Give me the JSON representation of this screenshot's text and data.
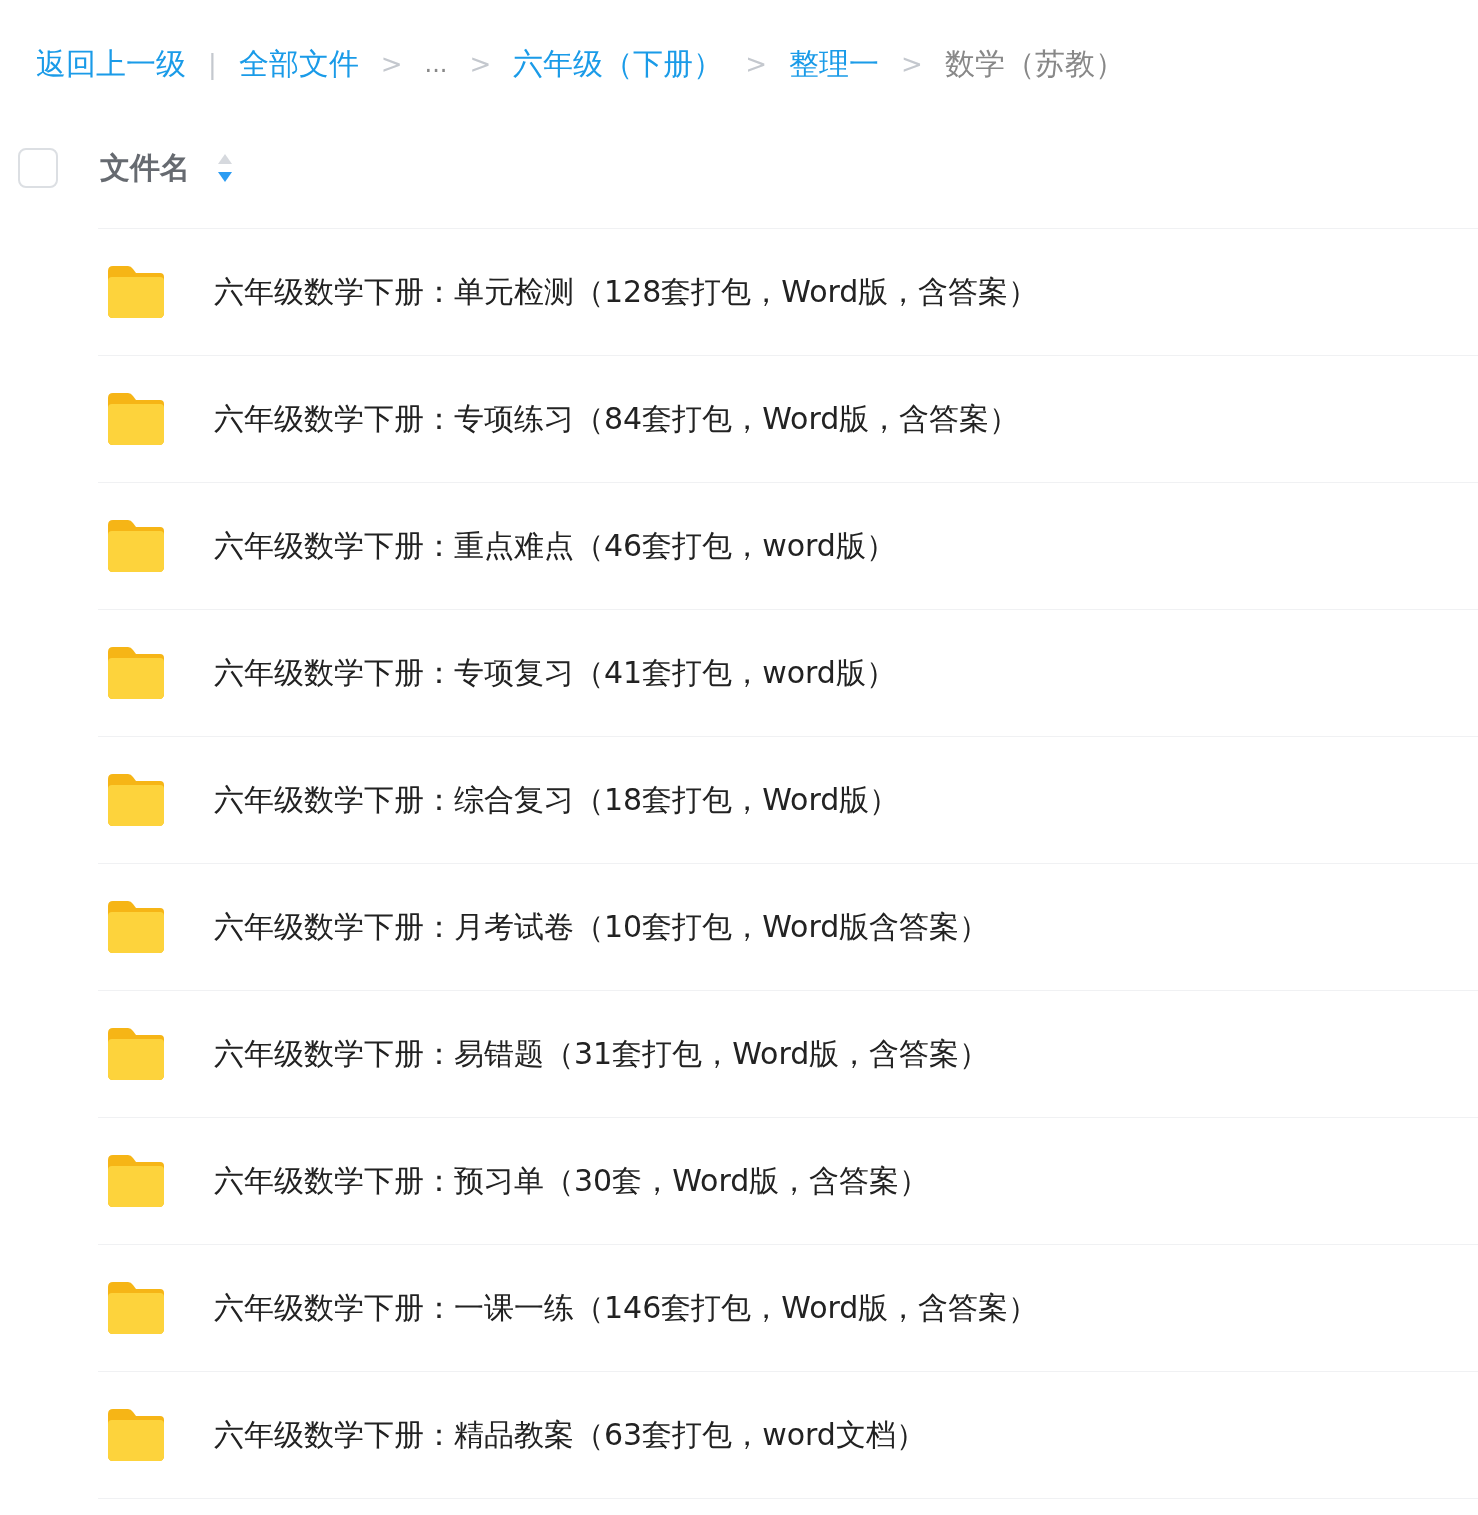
{
  "breadcrumb": [
    {
      "kind": "link",
      "text": "返回上一级"
    },
    {
      "kind": "divider",
      "text": "|"
    },
    {
      "kind": "link",
      "text": "全部文件"
    },
    {
      "kind": "separator",
      "text": ">"
    },
    {
      "kind": "ellipsis",
      "text": "..."
    },
    {
      "kind": "separator",
      "text": ">"
    },
    {
      "kind": "link",
      "text": "六年级（下册）"
    },
    {
      "kind": "separator",
      "text": ">"
    },
    {
      "kind": "link",
      "text": "整理一"
    },
    {
      "kind": "separator",
      "text": ">"
    },
    {
      "kind": "current",
      "text": "数学（苏教）"
    }
  ],
  "header": {
    "checked": false,
    "label": "文件名",
    "sort_descending": true
  },
  "files": [
    {
      "name": "六年级数学下册：单元检测（128套打包，Word版，含答案）"
    },
    {
      "name": "六年级数学下册：专项练习（84套打包，Word版，含答案）"
    },
    {
      "name": "六年级数学下册：重点难点（46套打包，word版）"
    },
    {
      "name": "六年级数学下册：专项复习（41套打包，word版）"
    },
    {
      "name": "六年级数学下册：综合复习（18套打包，Word版）"
    },
    {
      "name": "六年级数学下册：月考试卷（10套打包，Word版含答案）"
    },
    {
      "name": "六年级数学下册：易错题（31套打包，Word版，含答案）"
    },
    {
      "name": "六年级数学下册：预习单（30套，Word版，含答案）"
    },
    {
      "name": "六年级数学下册：一课一练（146套打包，Word版，含答案）"
    },
    {
      "name": "六年级数学下册：精品教案（63套打包，word文档）"
    }
  ]
}
